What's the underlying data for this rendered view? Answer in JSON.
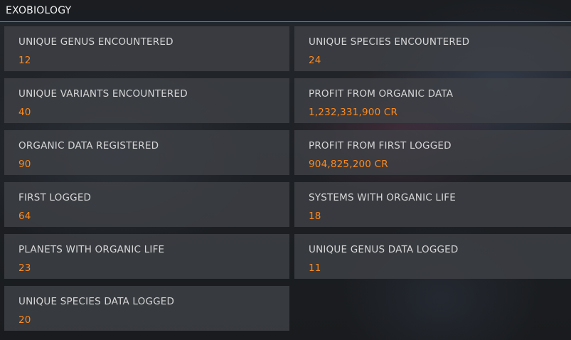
{
  "header": {
    "title": "EXOBIOLOGY"
  },
  "stats": [
    {
      "label": "UNIQUE GENUS ENCOUNTERED",
      "value": "12"
    },
    {
      "label": "UNIQUE SPECIES ENCOUNTERED",
      "value": "24"
    },
    {
      "label": "UNIQUE VARIANTS ENCOUNTERED",
      "value": "40"
    },
    {
      "label": "PROFIT FROM ORGANIC DATA",
      "value": "1,232,331,900 CR"
    },
    {
      "label": "ORGANIC DATA REGISTERED",
      "value": "90"
    },
    {
      "label": "PROFIT FROM FIRST LOGGED",
      "value": "904,825,200 CR"
    },
    {
      "label": "FIRST LOGGED",
      "value": "64"
    },
    {
      "label": "SYSTEMS WITH ORGANIC LIFE",
      "value": "18"
    },
    {
      "label": "PLANETS WITH ORGANIC LIFE",
      "value": "23"
    },
    {
      "label": "UNIQUE GENUS DATA LOGGED",
      "value": "11"
    },
    {
      "label": "UNIQUE SPECIES DATA LOGGED",
      "value": "20"
    }
  ],
  "colors": {
    "accent": "#ff8a1c",
    "label": "#d6d6d6",
    "card": "#3e4145",
    "divider": "#c56a1a"
  }
}
